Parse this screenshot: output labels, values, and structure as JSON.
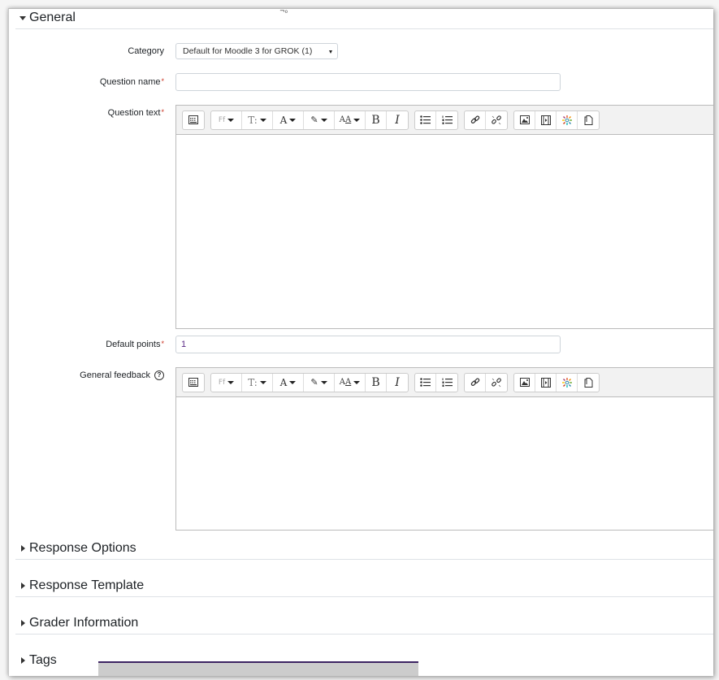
{
  "sections": {
    "general": {
      "title": "General",
      "expanded": true
    },
    "collapsed": [
      {
        "title": "Response Options"
      },
      {
        "title": "Response Template"
      },
      {
        "title": "Grader Information"
      },
      {
        "title": "Tags"
      }
    ]
  },
  "form": {
    "category": {
      "label": "Category",
      "value": "Default for Moodle 3 for GROK (1)"
    },
    "question_name": {
      "label": "Question name",
      "value": "",
      "required_marker": "*"
    },
    "question_text": {
      "label": "Question text",
      "required_marker": "*"
    },
    "default_points": {
      "label": "Default points",
      "value": "1",
      "required_marker": "*"
    },
    "general_feedback": {
      "label": "General feedback",
      "help_icon": "?"
    }
  },
  "toolbar": {
    "buttons": [
      {
        "name": "toolbar-toggle",
        "icon": "toolbar-toggle-icon"
      },
      {
        "name": "font-family",
        "glyph": "Ff"
      },
      {
        "name": "font-size",
        "glyph": "T:"
      },
      {
        "name": "font-color",
        "glyph": "A"
      },
      {
        "name": "background-color",
        "glyph": "✎/"
      },
      {
        "name": "styles",
        "glyph": "AA"
      },
      {
        "name": "bold",
        "glyph": "B"
      },
      {
        "name": "italic",
        "glyph": "I"
      },
      {
        "name": "unordered-list",
        "glyph": "☰"
      },
      {
        "name": "ordered-list",
        "glyph": "☰"
      },
      {
        "name": "link",
        "glyph": "🔗"
      },
      {
        "name": "unlink",
        "glyph": "⛓"
      },
      {
        "name": "image",
        "glyph": "▣"
      },
      {
        "name": "media",
        "glyph": "▦"
      },
      {
        "name": "h5p",
        "glyph": "❋"
      },
      {
        "name": "manage-files",
        "glyph": "⎗"
      }
    ]
  },
  "cursor_artifact": "¬₀"
}
